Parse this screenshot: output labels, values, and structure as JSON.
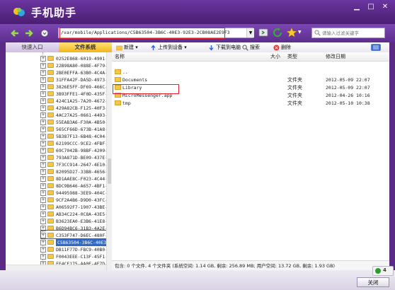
{
  "app": {
    "title": "手机助手"
  },
  "address": {
    "path": "/var/mobile/Applications/C5B63504-3B6C-40E3-92E3-2CB08AE2E9F3"
  },
  "search": {
    "placeholder": "请输入过滤关键字"
  },
  "left_tabs": [
    "快速入口",
    "文件系统"
  ],
  "tree": {
    "items": [
      "0252E868-6019-4901-",
      "22B98A80-088E-4F79-",
      "2BE0EFFA-63B0-4C4A-",
      "31FFA42F-DA5D-4973-",
      "3826E5FF-DF69-466C-",
      "3B93FFE1-4F0D-435F-",
      "424C1A25-7A20-4672-",
      "429A82CB-F125-40F3-",
      "4AC27A25-0661-4493-",
      "55EAB3A6-F30A-4B50-",
      "565CF66D-673B-41A8-",
      "5B387F13-6B48-4C04-",
      "62199CCC-9CE2-4FBF-",
      "69C7042B-98BF-4209-",
      "793A871D-BE09-437E-",
      "7F3CC914-2647-4E10-",
      "82095D27-33B8-4656-",
      "8D1AAE8C-F023-4C44-",
      "8DC9B646-A657-4BF1-",
      "94495988-3EE9-404C-",
      "9CF2A4B6-D9D0-43FC-",
      "A06592F7-1907-43BE-",
      "AB34C224-0C8A-43E5-",
      "B3623EA0-E3B6-41E8-",
      "B6D94BC6-31B3-4A2E-",
      "C353F747-D6EC-480F-",
      "C5B63504-3B6C-40E3-",
      "DB11F77D-FBC9-40B0-",
      "F0043EEE-C13F-45F1-",
      "FF4CF175-AA0E-4E7D-"
    ],
    "selected_index": 26
  },
  "toolbar": {
    "new": "新建",
    "upload": "上传到设备",
    "download": "下载到电脑",
    "search": "搜索",
    "delete": "删除"
  },
  "columns": {
    "name": "名称",
    "size": "大小",
    "type": "类型",
    "modified": "修改日期"
  },
  "files": [
    {
      "name": "..",
      "type": "",
      "date": ""
    },
    {
      "name": "Documents",
      "type": "文件夹",
      "date": "2012-05-09 22:07"
    },
    {
      "name": "Library",
      "type": "文件夹",
      "date": "2012-05-09 22:07"
    },
    {
      "name": "MicroMessenger.app",
      "type": "文件夹",
      "date": "2012-04-26 10:16"
    },
    {
      "name": "tmp",
      "type": "文件夹",
      "date": "2012-05-10 10:38"
    }
  ],
  "status": {
    "text": "包含: 0 个文件, 4 个文件夹   (系统空间: 1.14 GB, 剩余: 256.89 MB; 用户空间: 13.72 GB, 剩余: 1.93 GB)"
  },
  "buttons": {
    "close": "关闭"
  },
  "connection": {
    "count": "4"
  },
  "colors": {
    "title_bar": "#5a2a84",
    "highlight": "#e41f2c",
    "folder": "#f3c84a",
    "selection": "#316ac5"
  }
}
